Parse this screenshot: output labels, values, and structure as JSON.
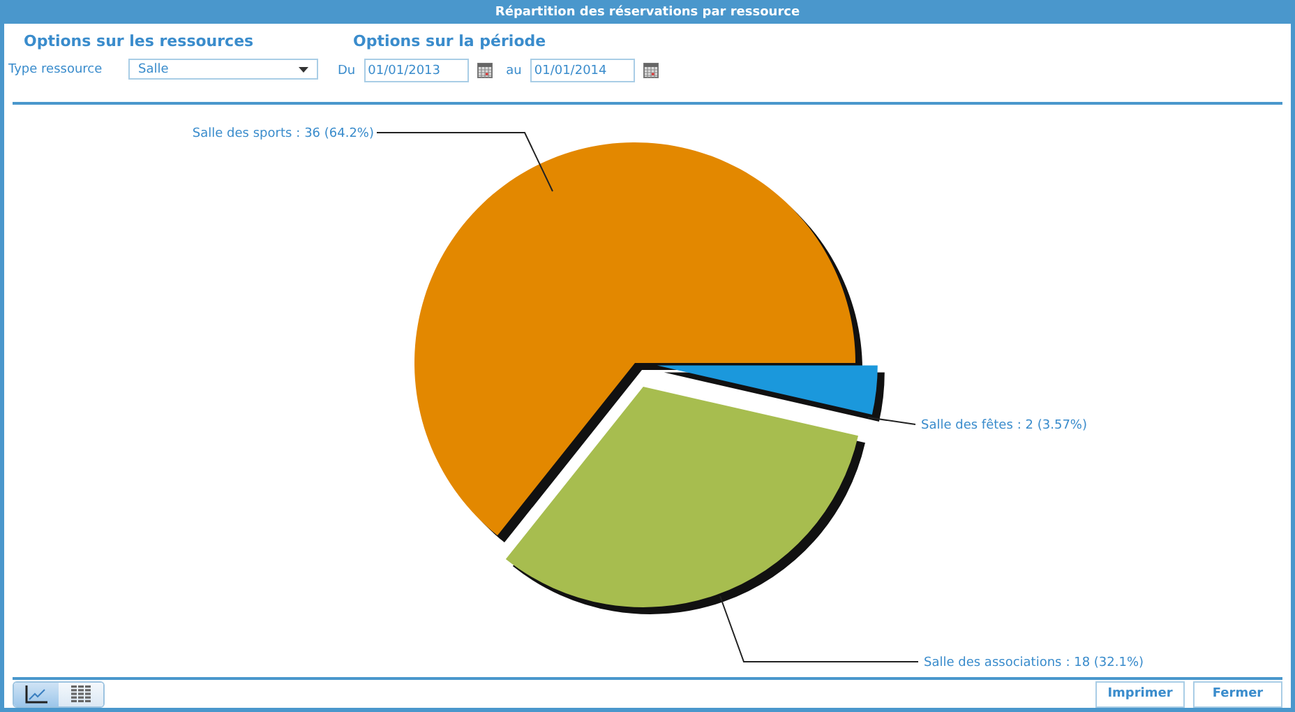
{
  "window": {
    "title": "Répartition des réservations par ressource"
  },
  "resources": {
    "heading": "Options sur les ressources",
    "type_label": "Type ressource",
    "type_value": "Salle"
  },
  "period": {
    "heading": "Options sur la période",
    "from_label": "Du",
    "from_value": "01/01/2013",
    "to_label": "au",
    "to_value": "01/01/2014"
  },
  "chart_data": {
    "type": "pie",
    "categories": [
      "Salle des sports",
      "Salle des fêtes",
      "Salle des associations"
    ],
    "values": [
      36,
      2,
      18
    ],
    "colors": [
      "#e38800",
      "#1b98dc",
      "#a7bd4f"
    ],
    "value_labels": [
      ": 36 (64.2%)",
      ": 2 (3.57%)",
      ": 18 (32.1%)"
    ]
  },
  "view_toggle": [
    {
      "kind": "chart",
      "selected": true
    },
    {
      "kind": "table",
      "selected": false
    }
  ],
  "buttons": [
    "Imprimer",
    "Fermer"
  ]
}
